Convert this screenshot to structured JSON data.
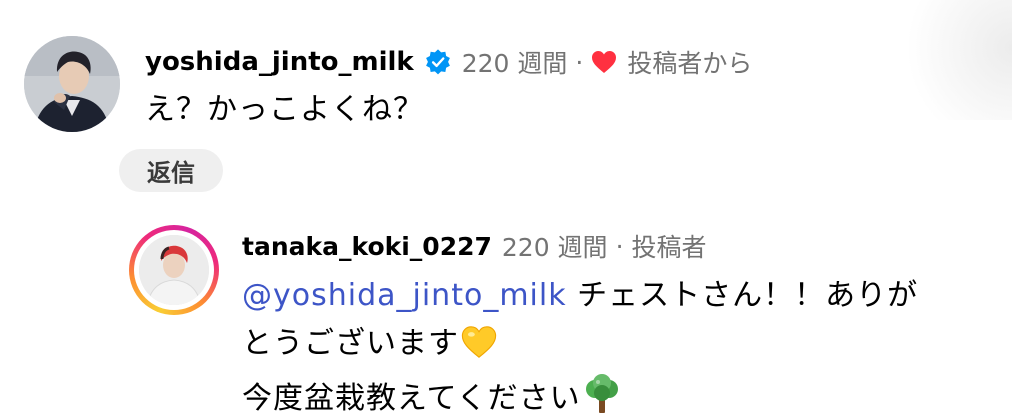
{
  "colors": {
    "mention": "#3d55c7",
    "meta_gray": "#737373",
    "heart_red": "#ff3040",
    "verified_blue": "#0095f6"
  },
  "comment": {
    "username": "yoshida_jinto_milk",
    "verified_icon": "verified-badge-icon",
    "time": "220 週間",
    "separator": "·",
    "liked_icon": "heart-icon",
    "liked_by_author": "投稿者から",
    "text": "え？かっこよくね？",
    "reply_label": "返信"
  },
  "reply": {
    "username": "tanaka_koki_0227",
    "time": "220 週間",
    "separator": "·",
    "author_badge": "投稿者",
    "mention": "@yoshida_jinto_milk",
    "text_line1": " チェストさん！！ありが",
    "text_line2": "とうございます",
    "emoji1_icon": "yellow-heart-icon",
    "text_line3": "今度盆栽教えてください",
    "emoji2_icon": "tree-icon"
  }
}
